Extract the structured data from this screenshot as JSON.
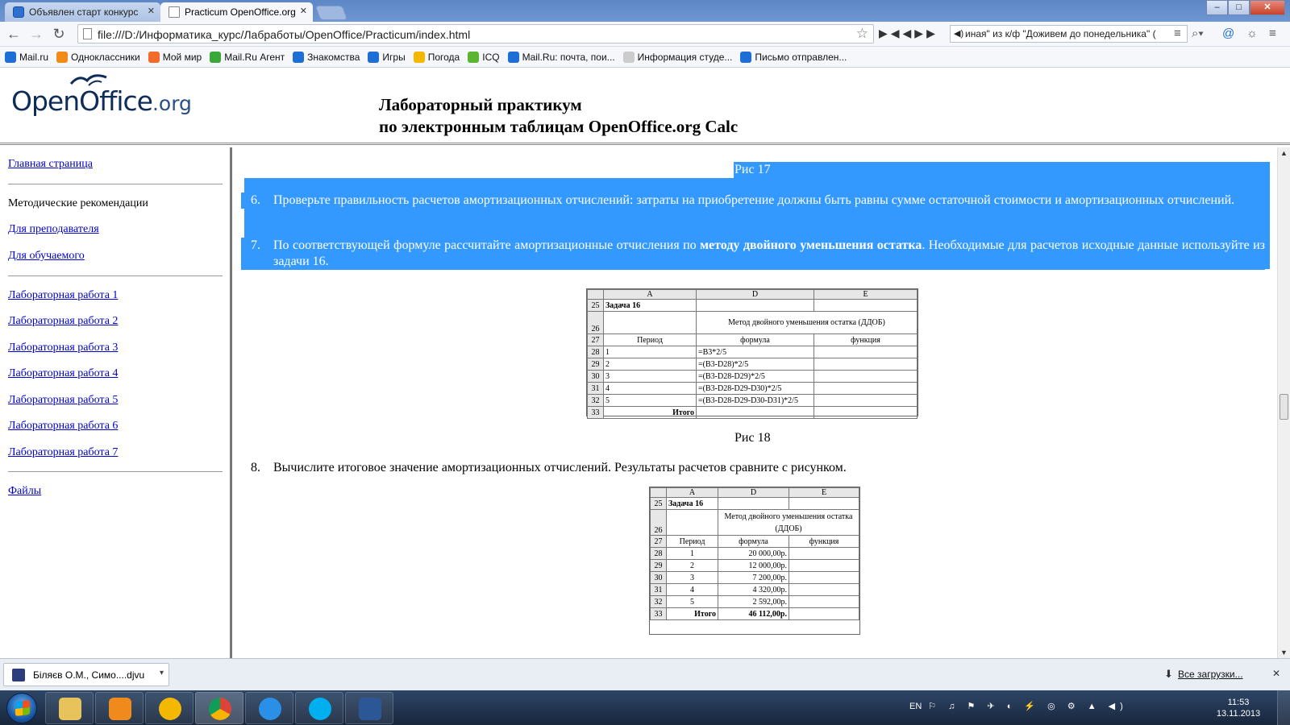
{
  "browser": {
    "tabs": [
      {
        "title": "Объявлен старт конкурс",
        "active": false
      },
      {
        "title": "Practicum OpenOffice.org",
        "active": true
      }
    ],
    "close_glyph": "✕",
    "url": "file:///D:/Информатика_курс/Лабработы/OpenOffice/Practicum/index.html",
    "search_text": "иная\" из к/ф \"Доживем до понедельника\" (",
    "bookmarks": [
      {
        "label": "Mail.ru",
        "color": "#1d6fd6"
      },
      {
        "label": "Одноклассники",
        "color": "#f28a17"
      },
      {
        "label": "Мой мир",
        "color": "#f26b2a"
      },
      {
        "label": "Mail.Ru Агент",
        "color": "#3aa83a"
      },
      {
        "label": "Знакомства",
        "color": "#1d6fd6"
      },
      {
        "label": "Игры",
        "color": "#1d6fd6"
      },
      {
        "label": "Погода",
        "color": "#f5b800"
      },
      {
        "label": "ICQ",
        "color": "#5cb531"
      },
      {
        "label": "Mail.Ru: почта, пои...",
        "color": "#1d6fd6"
      },
      {
        "label": "Информация студе...",
        "color": "#cccccc"
      },
      {
        "label": "Письмо отправлен...",
        "color": "#1d6fd6"
      }
    ]
  },
  "site": {
    "logo_main": "OpenOffice",
    "logo_suffix": ".org",
    "title_line1": "Лабораторный практикум",
    "title_line2": "по электронным таблицам OpenOffice.org Calc"
  },
  "sidebar": {
    "home": "Главная страница",
    "methods": "Методические рекомендации",
    "for_teacher": "Для преподавателя",
    "for_student": "Для обучаемого",
    "labs": [
      "Лабораторная работа 1",
      "Лабораторная работа 2",
      "Лабораторная работа 3",
      "Лабораторная работа 4",
      "Лабораторная работа 5",
      "Лабораторная работа 6",
      "Лабораторная работа 7"
    ],
    "files": "Файлы"
  },
  "content": {
    "fig17": "Рис 17",
    "item6_num": "6.",
    "item6": "Проверьте правильность расчетов амортизационных отчислений: затраты на приобретение должны быть равны сумме остаточной стоимости и амортизационных отчислений.",
    "item7_num": "7.",
    "item7_pre": "По соответствующей формуле рассчитайте амортизационные отчисления по ",
    "item7_bold": "методу двойного уменьшения остатка",
    "item7_post": ". Необходимые для расчетов исходные данные используйте из задачи 16.",
    "fig18": "Рис 18",
    "item8_num": "8.",
    "item8": "Вычислите итоговое значение амортизационных отчислений. Результаты расчетов сравните с рисунком.",
    "sheet1": {
      "col_a": "A",
      "col_d": "D",
      "col_e": "E",
      "rows": [
        "25",
        "26",
        "27",
        "28",
        "29",
        "30",
        "31",
        "32",
        "33"
      ],
      "task": "Задача 16",
      "method": "Метод двойного уменьшения остатка (ДДОБ)",
      "period": "Период",
      "formula": "формула",
      "function": "функция",
      "periods": [
        "1",
        "2",
        "3",
        "4",
        "5"
      ],
      "formulas": [
        "=B3*2/5",
        "=(B3-D28)*2/5",
        "=(B3-D28-D29)*2/5",
        "=(B3-D28-D29-D30)*2/5",
        "=(B3-D28-D29-D30-D31)*2/5"
      ],
      "total": "Итого"
    },
    "sheet2": {
      "col_a": "A",
      "col_d": "D",
      "col_e": "E",
      "rows": [
        "25",
        "26",
        "27",
        "28",
        "29",
        "30",
        "31",
        "32",
        "33"
      ],
      "task": "Задача 16",
      "method": "Метод двойного уменьшения остатка (ДДОБ)",
      "period": "Период",
      "formula": "формула",
      "function": "функция",
      "periods": [
        "1",
        "2",
        "3",
        "4",
        "5"
      ],
      "values": [
        "20 000,00р.",
        "12 000,00р.",
        "7 200,00р.",
        "4 320,00р.",
        "2 592,00р."
      ],
      "total": "Итого",
      "total_value": "46 112,00р."
    }
  },
  "downloads": {
    "file": "Біляєв О.М., Симо....djvu",
    "all": "Все загрузки..."
  },
  "taskbar": {
    "lang": "EN",
    "time": "11:53",
    "date": "13.11.2013"
  }
}
